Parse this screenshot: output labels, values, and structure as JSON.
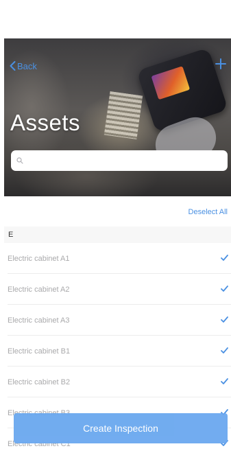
{
  "nav": {
    "back_label": "Back",
    "add_icon": "plus-icon",
    "back_icon": "chevron-left-icon"
  },
  "header": {
    "title": "Assets"
  },
  "search": {
    "placeholder": "",
    "value": "",
    "icon": "search-icon"
  },
  "actions": {
    "deselect_label": "Deselect All"
  },
  "section": {
    "letter": "E"
  },
  "assets": [
    {
      "label": "Electric cabinet A1",
      "selected": true
    },
    {
      "label": "Electric cabinet A2",
      "selected": true
    },
    {
      "label": "Electric cabinet A3",
      "selected": true
    },
    {
      "label": "Electric cabinet B1",
      "selected": true
    },
    {
      "label": "Electric cabinet B2",
      "selected": true
    },
    {
      "label": "Electric cabinet B3",
      "selected": true
    },
    {
      "label": "Electric cabinet C1",
      "selected": true
    }
  ],
  "footer": {
    "create_label": "Create Inspection"
  },
  "colors": {
    "accent": "#4a90e2",
    "button": "#6aa8ef",
    "row_text": "#a9a9ab"
  }
}
